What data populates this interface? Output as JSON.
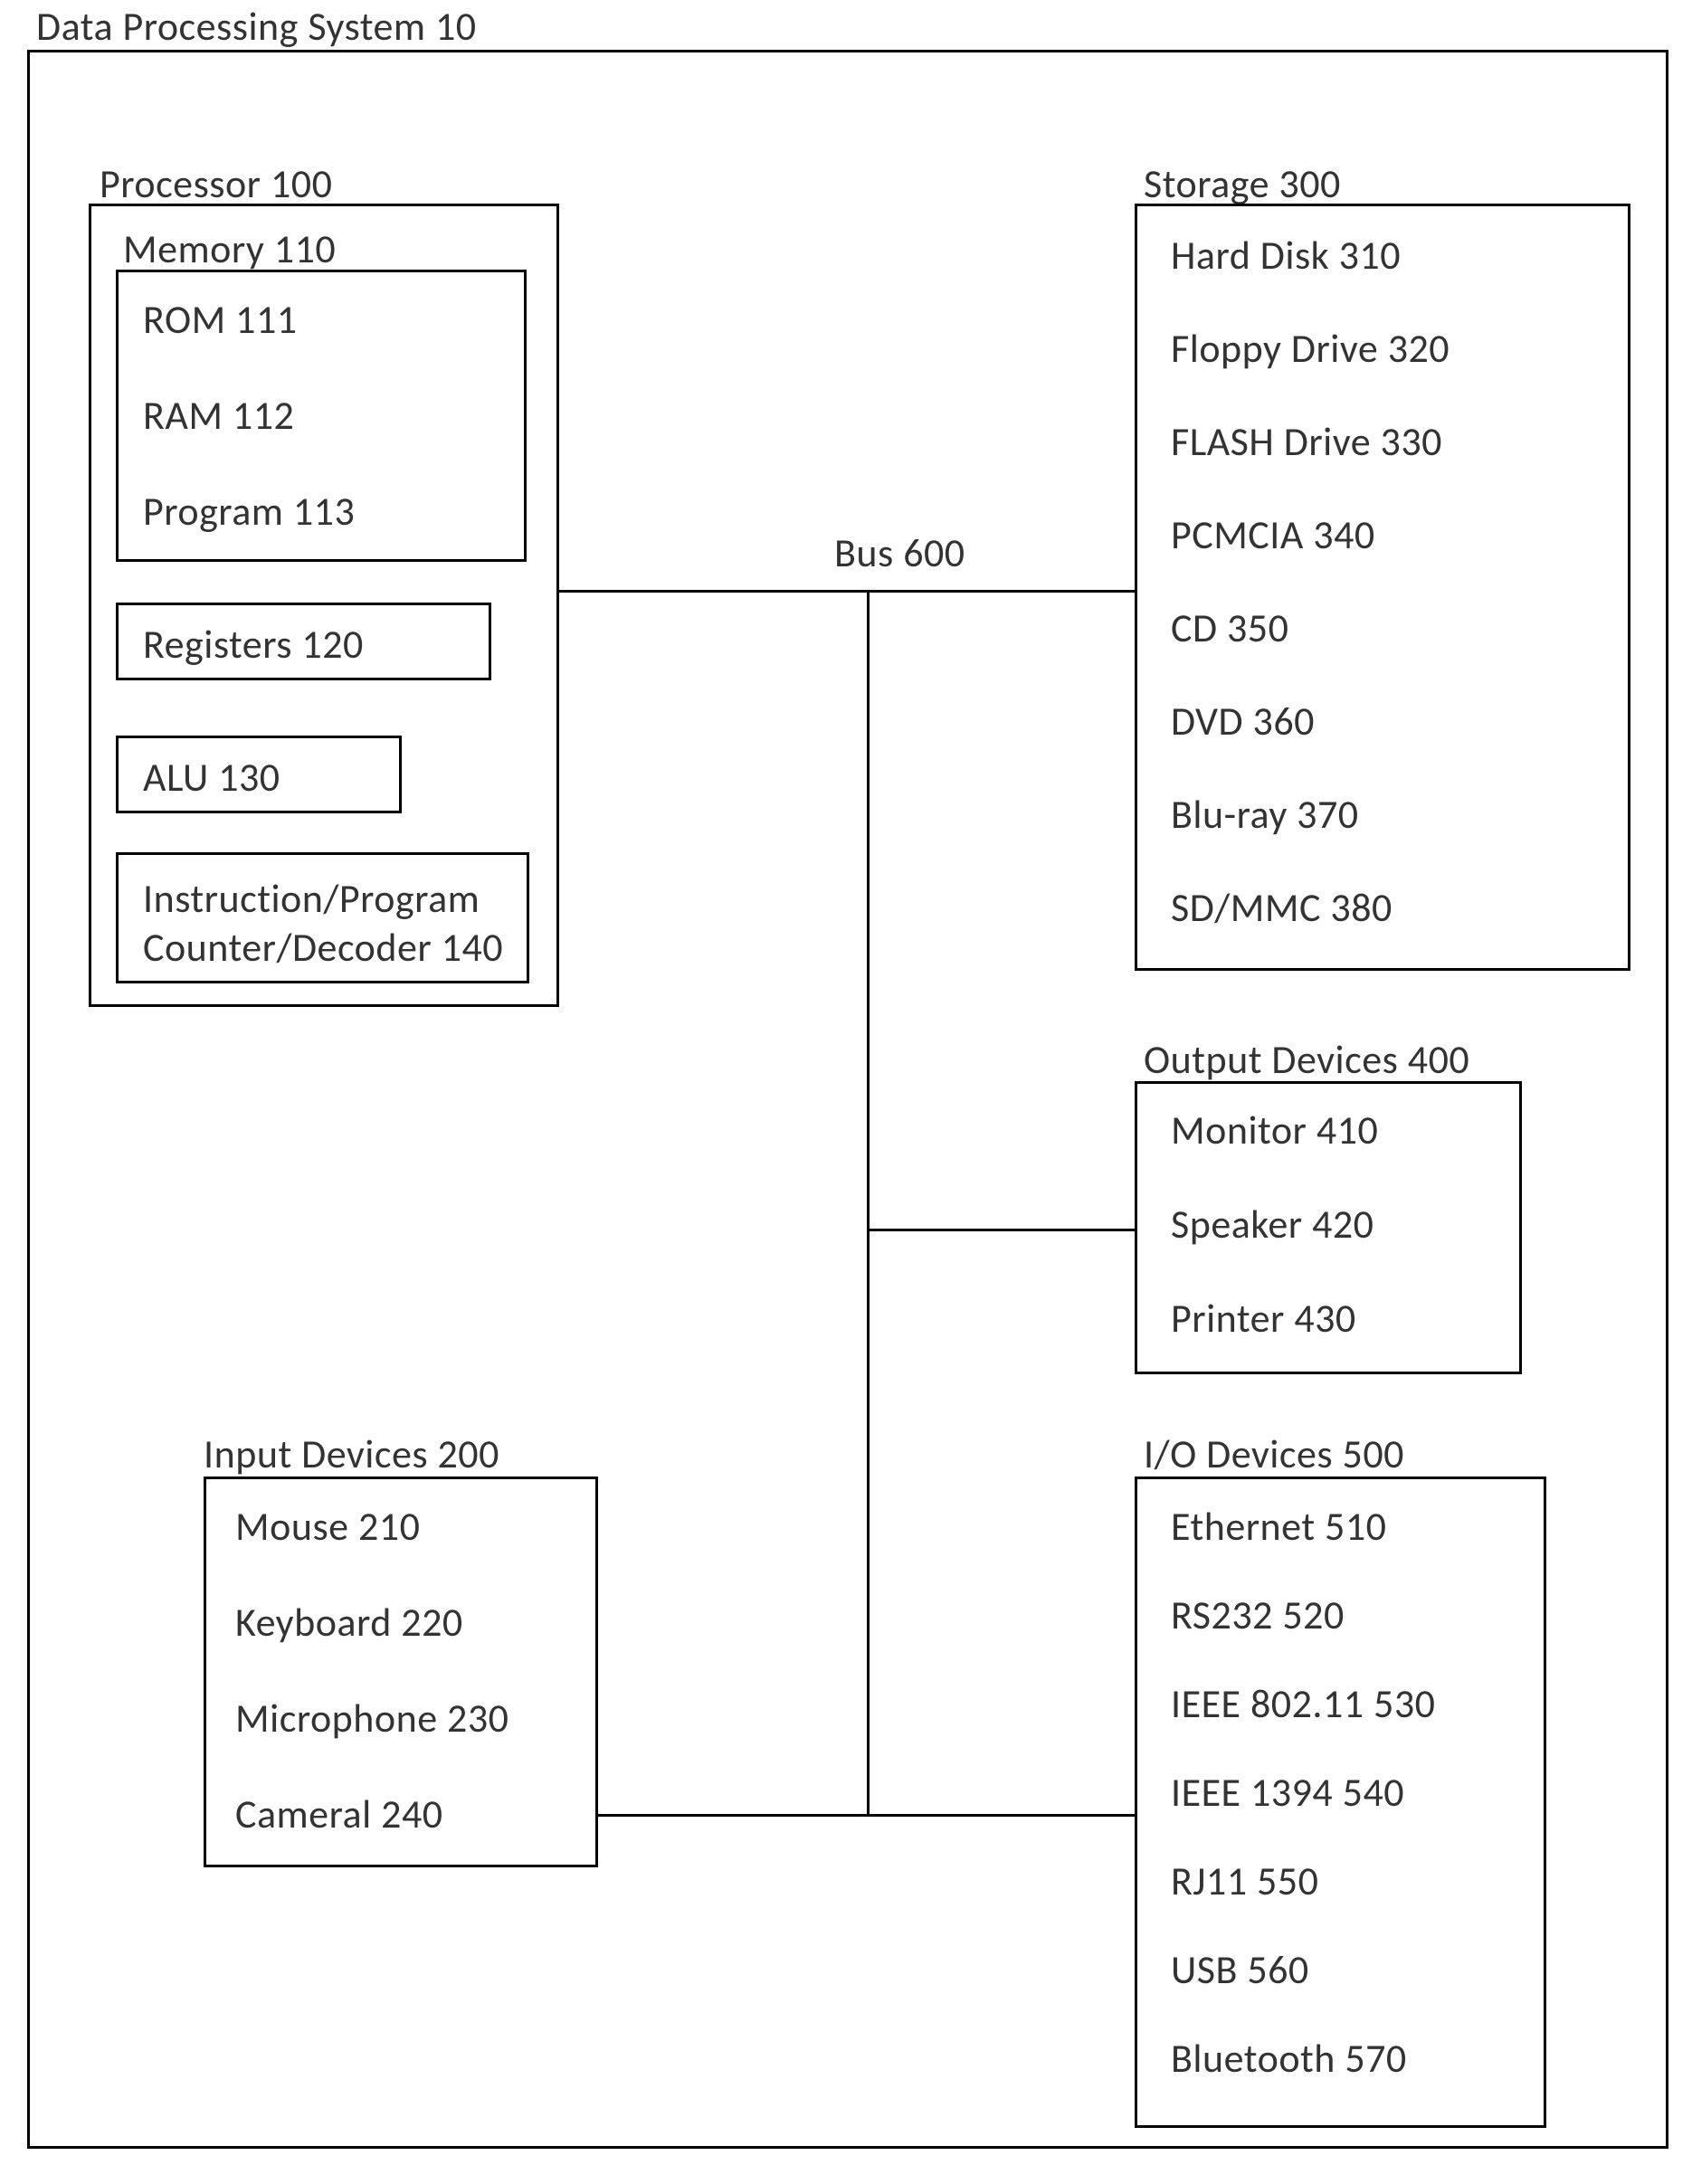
{
  "system": {
    "title": "Data Processing System 10"
  },
  "bus": {
    "label": "Bus 600"
  },
  "processor": {
    "title": "Processor 100",
    "memory": {
      "title": "Memory 110",
      "rom": "ROM 111",
      "ram": "RAM 112",
      "program": "Program 113"
    },
    "registers": "Registers 120",
    "alu": "ALU 130",
    "counter": "Instruction/Program\nCounter/Decoder 140"
  },
  "storage": {
    "title": "Storage 300",
    "items": [
      "Hard Disk 310",
      "Floppy Drive 320",
      "FLASH Drive 330",
      "PCMCIA 340",
      "CD 350",
      "DVD 360",
      "Blu-ray 370",
      "SD/MMC 380"
    ]
  },
  "input": {
    "title": "Input Devices 200",
    "items": [
      "Mouse 210",
      "Keyboard 220",
      "Microphone 230",
      "Cameral 240"
    ]
  },
  "output": {
    "title": "Output Devices 400",
    "items": [
      "Monitor 410",
      "Speaker 420",
      "Printer 430"
    ]
  },
  "io": {
    "title": "I/O Devices 500",
    "items": [
      "Ethernet 510",
      "RS232 520",
      "IEEE 802.11 530",
      "IEEE 1394 540",
      "RJ11 550",
      "USB 560",
      "Bluetooth 570"
    ]
  }
}
